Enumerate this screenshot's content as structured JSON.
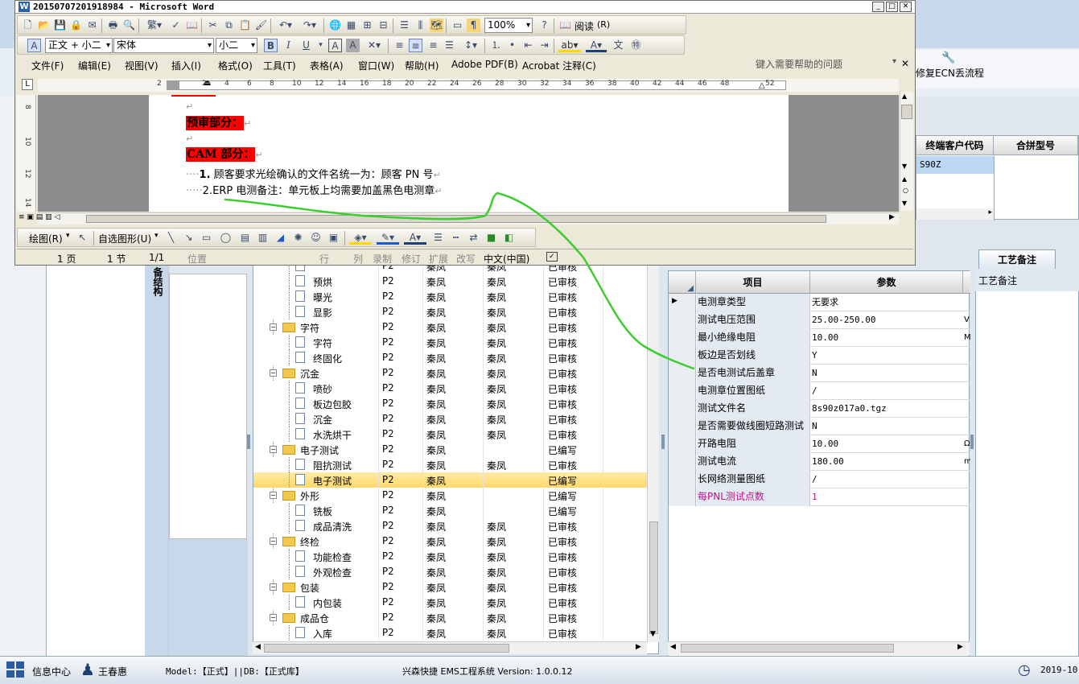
{
  "word": {
    "title": "20150707201918984 - Microsoft Word",
    "style_combo": "正文 + 小二",
    "font_combo": "宋体",
    "size_combo": "小二",
    "zoom": "100%",
    "read_label": "阅读",
    "read_key": "(R)",
    "menus": [
      "文件(F)",
      "编辑(E)",
      "视图(V)",
      "插入(I)",
      "格式(O)",
      "工具(T)",
      "表格(A)",
      "窗口(W)",
      "帮助(H)",
      "Adobe PDF(B)",
      "Acrobat 注释(C)"
    ],
    "help_placeholder": "键入需要帮助的问题",
    "ruler_ticks": [
      "2",
      "2",
      "4",
      "6",
      "8",
      "10",
      "12",
      "14",
      "16",
      "18",
      "20",
      "22",
      "24",
      "26",
      "28",
      "30",
      "32",
      "34",
      "36",
      "38",
      "40",
      "42",
      "44",
      "46",
      "48",
      "52"
    ],
    "vruler_ticks": [
      "8",
      "10",
      "12",
      "14"
    ],
    "doc": {
      "heading1": "预审部分：",
      "heading2": "CAM 部分：",
      "item1_num": "1.",
      "item1": "顾客要求光绘确认的文件名统一为：顾客 PN 号",
      "item2": "2.ERP 电测备注：单元板上均需要加盖黑色电测章",
      "mark": "↵"
    },
    "draw_label": "绘图(R)",
    "autoshape_label": "自选图形(U)",
    "status": {
      "page": "1 页",
      "section": "1 节",
      "pages": "1/1",
      "position": "位置",
      "line": "行",
      "col": "列",
      "rec": "录制",
      "trk": "修订",
      "ext": "扩展",
      "ovr": "改写",
      "lang": "中文(中国)"
    }
  },
  "ecn_button": "修复ECN丢流程",
  "right_table": {
    "headers": [
      "终端客户代码",
      "合拼型号"
    ],
    "cell": "S90Z"
  },
  "nav_title": "备结构",
  "tree": {
    "rows": [
      {
        "name": "",
        "level": 2,
        "folder": false,
        "c1": "P2",
        "c2": "秦凤",
        "c3": "秦凤",
        "c4": "已审核"
      },
      {
        "name": "预烘",
        "level": 2,
        "folder": false,
        "c1": "P2",
        "c2": "秦凤",
        "c3": "秦凤",
        "c4": "已审核"
      },
      {
        "name": "曝光",
        "level": 2,
        "folder": false,
        "c1": "P2",
        "c2": "秦凤",
        "c3": "秦凤",
        "c4": "已审核"
      },
      {
        "name": "显影",
        "level": 2,
        "folder": false,
        "c1": "P2",
        "c2": "秦凤",
        "c3": "秦凤",
        "c4": "已审核"
      },
      {
        "name": "字符",
        "level": 1,
        "folder": true,
        "c1": "P2",
        "c2": "秦凤",
        "c3": "秦凤",
        "c4": "已审核"
      },
      {
        "name": "字符",
        "level": 2,
        "folder": false,
        "c1": "P2",
        "c2": "秦凤",
        "c3": "秦凤",
        "c4": "已审核"
      },
      {
        "name": "终固化",
        "level": 2,
        "folder": false,
        "c1": "P2",
        "c2": "秦凤",
        "c3": "秦凤",
        "c4": "已审核"
      },
      {
        "name": "沉金",
        "level": 1,
        "folder": true,
        "c1": "P2",
        "c2": "秦凤",
        "c3": "秦凤",
        "c4": "已审核"
      },
      {
        "name": "喷砂",
        "level": 2,
        "folder": false,
        "c1": "P2",
        "c2": "秦凤",
        "c3": "秦凤",
        "c4": "已审核"
      },
      {
        "name": "板边包胶",
        "level": 2,
        "folder": false,
        "c1": "P2",
        "c2": "秦凤",
        "c3": "秦凤",
        "c4": "已审核"
      },
      {
        "name": "沉金",
        "level": 2,
        "folder": false,
        "c1": "P2",
        "c2": "秦凤",
        "c3": "秦凤",
        "c4": "已审核"
      },
      {
        "name": "水洗烘干",
        "level": 2,
        "folder": false,
        "c1": "P2",
        "c2": "秦凤",
        "c3": "秦凤",
        "c4": "已审核"
      },
      {
        "name": "电子测试",
        "level": 1,
        "folder": true,
        "c1": "P2",
        "c2": "秦凤",
        "c3": "",
        "c4": "已编写"
      },
      {
        "name": "阻抗测试",
        "level": 2,
        "folder": false,
        "c1": "P2",
        "c2": "秦凤",
        "c3": "秦凤",
        "c4": "已审核"
      },
      {
        "name": "电子测试",
        "level": 2,
        "folder": false,
        "c1": "P2",
        "c2": "秦凤",
        "c3": "",
        "c4": "已编写",
        "selected": true
      },
      {
        "name": "外形",
        "level": 1,
        "folder": true,
        "c1": "P2",
        "c2": "秦凤",
        "c3": "",
        "c4": "已编写"
      },
      {
        "name": "铣板",
        "level": 2,
        "folder": false,
        "c1": "P2",
        "c2": "秦凤",
        "c3": "",
        "c4": "已编写"
      },
      {
        "name": "成品清洗",
        "level": 2,
        "folder": false,
        "c1": "P2",
        "c2": "秦凤",
        "c3": "秦凤",
        "c4": "已审核"
      },
      {
        "name": "终检",
        "level": 1,
        "folder": true,
        "c1": "P2",
        "c2": "秦凤",
        "c3": "秦凤",
        "c4": "已审核"
      },
      {
        "name": "功能检查",
        "level": 2,
        "folder": false,
        "c1": "P2",
        "c2": "秦凤",
        "c3": "秦凤",
        "c4": "已审核"
      },
      {
        "name": "外观检查",
        "level": 2,
        "folder": false,
        "c1": "P2",
        "c2": "秦凤",
        "c3": "秦凤",
        "c4": "已审核"
      },
      {
        "name": "包装",
        "level": 1,
        "folder": true,
        "c1": "P2",
        "c2": "秦凤",
        "c3": "秦凤",
        "c4": "已审核"
      },
      {
        "name": "内包装",
        "level": 2,
        "folder": false,
        "c1": "P2",
        "c2": "秦凤",
        "c3": "秦凤",
        "c4": "已审核"
      },
      {
        "name": "成品仓",
        "level": 1,
        "folder": true,
        "c1": "P2",
        "c2": "秦凤",
        "c3": "秦凤",
        "c4": "已审核"
      },
      {
        "name": "入库",
        "level": 2,
        "folder": false,
        "c1": "P2",
        "c2": "秦凤",
        "c3": "秦凤",
        "c4": "已审核"
      }
    ]
  },
  "params": {
    "headers": [
      "项目",
      "参数"
    ],
    "rows": [
      {
        "k": "电测章类型",
        "v": "无要求",
        "current": true
      },
      {
        "k": "测试电压范围",
        "v": "25.00-250.00",
        "unit": "V"
      },
      {
        "k": "最小绝缘电阻",
        "v": "10.00",
        "unit": "M"
      },
      {
        "k": "板边是否划线",
        "v": "Y"
      },
      {
        "k": "是否电测试后盖章",
        "v": "N"
      },
      {
        "k": "电测章位置图纸",
        "v": "/"
      },
      {
        "k": "测试文件名",
        "v": "8s90z017a0.tgz"
      },
      {
        "k": "是否需要做线圈短路测试",
        "v": "N"
      },
      {
        "k": "开路电阻",
        "v": "10.00",
        "unit": "Ω"
      },
      {
        "k": "测试电流",
        "v": "180.00",
        "unit": "m"
      },
      {
        "k": "长网络测量图纸",
        "v": "/"
      },
      {
        "k": "每PNL测试点数",
        "v": "1",
        "highlight": true
      }
    ],
    "highlight_color": "#c0138c"
  },
  "memo": {
    "tab": "工艺备注",
    "header": "工艺备注"
  },
  "statusbar": {
    "info_center": "信息中心",
    "user": "王春惠",
    "model": "Model:【正式】||DB:【正式库】",
    "system": "兴森快捷 EMS工程系统 Version: 1.0.0.12",
    "date": "2019-10-"
  }
}
